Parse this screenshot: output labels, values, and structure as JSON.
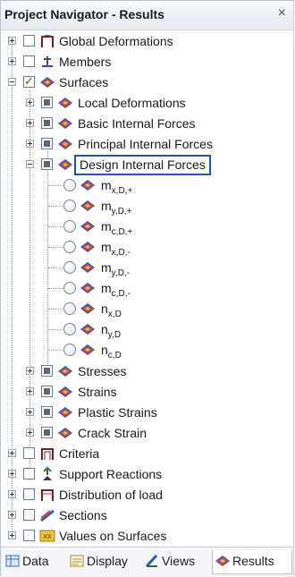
{
  "panel": {
    "title": "Project Navigator - Results",
    "close_glyph": "×"
  },
  "tree": {
    "global_deformations": "Global Deformations",
    "members": "Members",
    "surfaces": "Surfaces",
    "local_deformations": "Local Deformations",
    "basic_internal_forces": "Basic Internal Forces",
    "principal_internal_forces": "Principal Internal Forces",
    "design_internal_forces": "Design Internal Forces",
    "design_items": [
      {
        "base": "m",
        "sub": "x,D,+"
      },
      {
        "base": "m",
        "sub": "y,D,+"
      },
      {
        "base": "m",
        "sub": "c,D,+"
      },
      {
        "base": "m",
        "sub": "x,D,-"
      },
      {
        "base": "m",
        "sub": "y,D,-"
      },
      {
        "base": "m",
        "sub": "c,D,-"
      },
      {
        "base": "n",
        "sub": "x,D"
      },
      {
        "base": "n",
        "sub": "y,D"
      },
      {
        "base": "n",
        "sub": "c,D"
      }
    ],
    "stresses": "Stresses",
    "strains": "Strains",
    "plastic_strains": "Plastic Strains",
    "crack_strain": "Crack Strain",
    "criteria": "Criteria",
    "support_reactions": "Support Reactions",
    "distribution_of_load": "Distribution of load",
    "sections": "Sections",
    "values_on_surfaces": "Values on Surfaces",
    "values_icon_text": "XX"
  },
  "tabs": {
    "data": "Data",
    "display": "Display",
    "views": "Views",
    "results": "Results"
  },
  "colors": {
    "selection_border": "#1f4fd6",
    "surface_icon_blue": "#2a5ad8",
    "surface_icon_red": "#e0442b",
    "surface_icon_yellow": "#f2c12e",
    "checkbox_green": "#2a6e1b"
  }
}
